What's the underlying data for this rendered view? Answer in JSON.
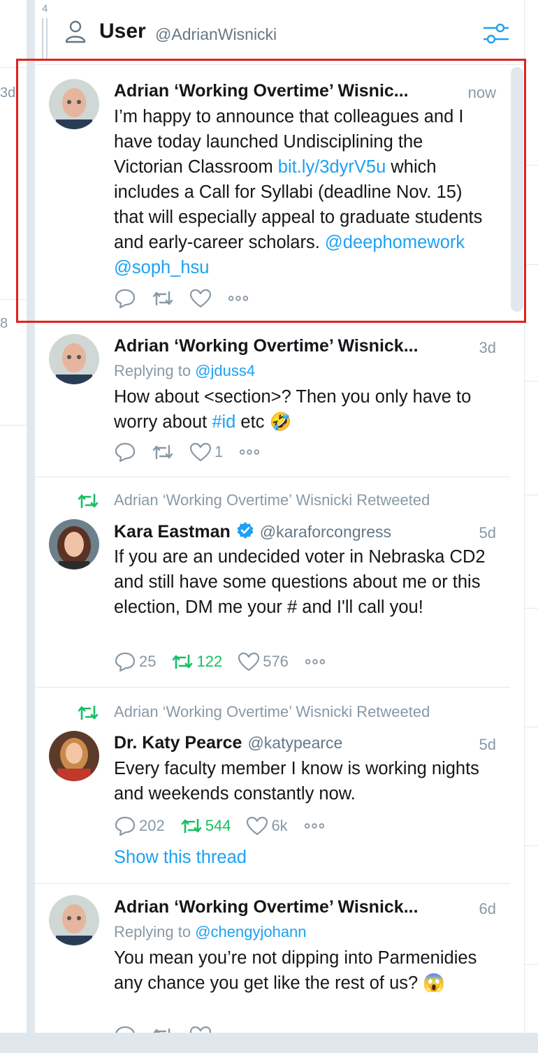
{
  "left_column": {
    "fragment_top": "3d",
    "fragment_mid": "8"
  },
  "header": {
    "column_number": "4",
    "title": "User",
    "handle": "@AdrianWisnicki"
  },
  "tweets": [
    {
      "name": "Adrian ‘Working Overtime’ Wisnic...",
      "time": "now",
      "text_parts": [
        "I’m happy to announce that colleagues and I have today launched Undisciplining the Victorian Classroom ",
        "bit.ly/3dyrV5u",
        " which includes a Call for Syllabi (deadline Nov. 15) that will especially appeal to graduate students and early-career scholars. ",
        "@deephomework",
        " ",
        "@soph_hsu"
      ]
    },
    {
      "name": "Adrian ‘Working Overtime’ Wisnick...",
      "time": "3d",
      "replying_label": "Replying to ",
      "replying_to": "@jduss4",
      "text_parts": [
        "How about <section>? Then you only have to worry about ",
        "#id",
        " etc 🤣"
      ],
      "likes": "1"
    },
    {
      "retweeted_by": "Adrian ‘Working Overtime’ Wisnicki Retweeted",
      "name": "Kara Eastman",
      "handle": "@karaforcongress",
      "time": "5d",
      "text": "If you are an undecided voter in Nebraska CD2 and still have some questions about me or this election, DM me your # and I'll call you!",
      "replies": "25",
      "retweets": "122",
      "likes": "576"
    },
    {
      "retweeted_by": "Adrian ‘Working Overtime’ Wisnicki Retweeted",
      "name": "Dr. Katy Pearce",
      "handle": "@katypearce",
      "time": "5d",
      "text": "Every faculty member I know is working nights and weekends constantly now.",
      "replies": "202",
      "retweets": "544",
      "likes": "6k",
      "show_thread": "Show this thread"
    },
    {
      "name": "Adrian ‘Working Overtime’ Wisnick...",
      "time": "6d",
      "replying_label": "Replying to ",
      "replying_to": "@chengyjohann",
      "text": "You mean you’re not dipping into Parmenidies any chance you get like the rest of us? 😱"
    }
  ],
  "colors": {
    "accent": "#1da1f2",
    "retweet": "#17bf63",
    "highlight": "#e0221f",
    "muted": "#8899a6"
  }
}
